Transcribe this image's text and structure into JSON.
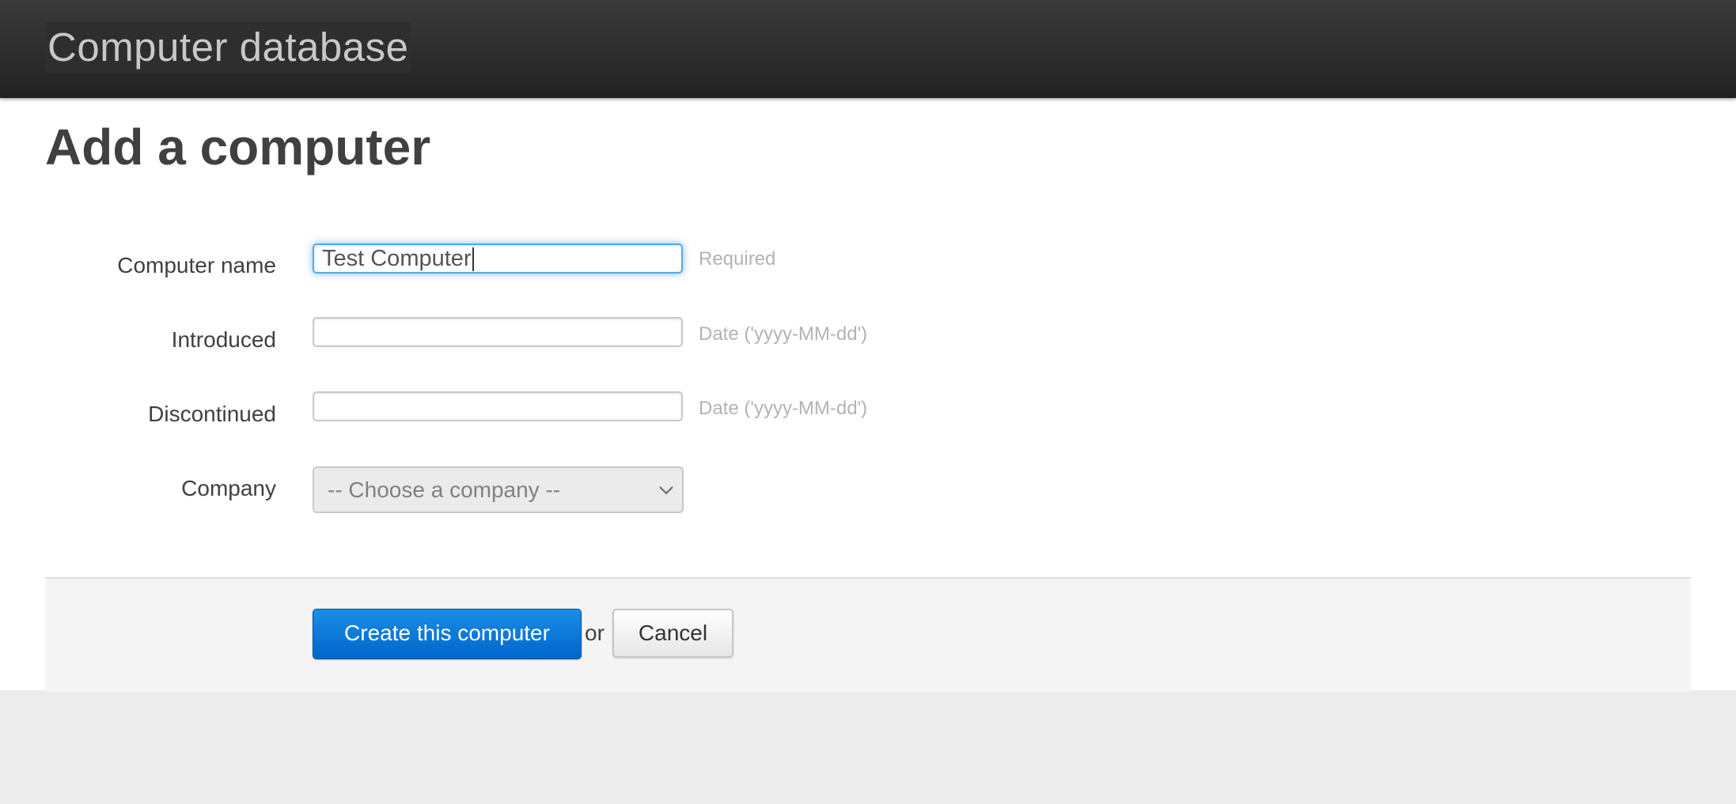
{
  "header": {
    "brand": "Computer database"
  },
  "page": {
    "title": "Add a computer"
  },
  "form": {
    "name": {
      "label": "Computer name",
      "value": "Test Computer",
      "help": "Required"
    },
    "introduced": {
      "label": "Introduced",
      "value": "",
      "help": "Date ('yyyy-MM-dd')"
    },
    "discontinued": {
      "label": "Discontinued",
      "value": "",
      "help": "Date ('yyyy-MM-dd')"
    },
    "company": {
      "label": "Company",
      "selected": "-- Choose a company --"
    }
  },
  "actions": {
    "create_label": "Create this computer",
    "or_text": "or",
    "cancel_label": "Cancel"
  },
  "colors": {
    "primary": "#0066cc",
    "focus": "#5aa9e6",
    "topbar": "#222222"
  }
}
